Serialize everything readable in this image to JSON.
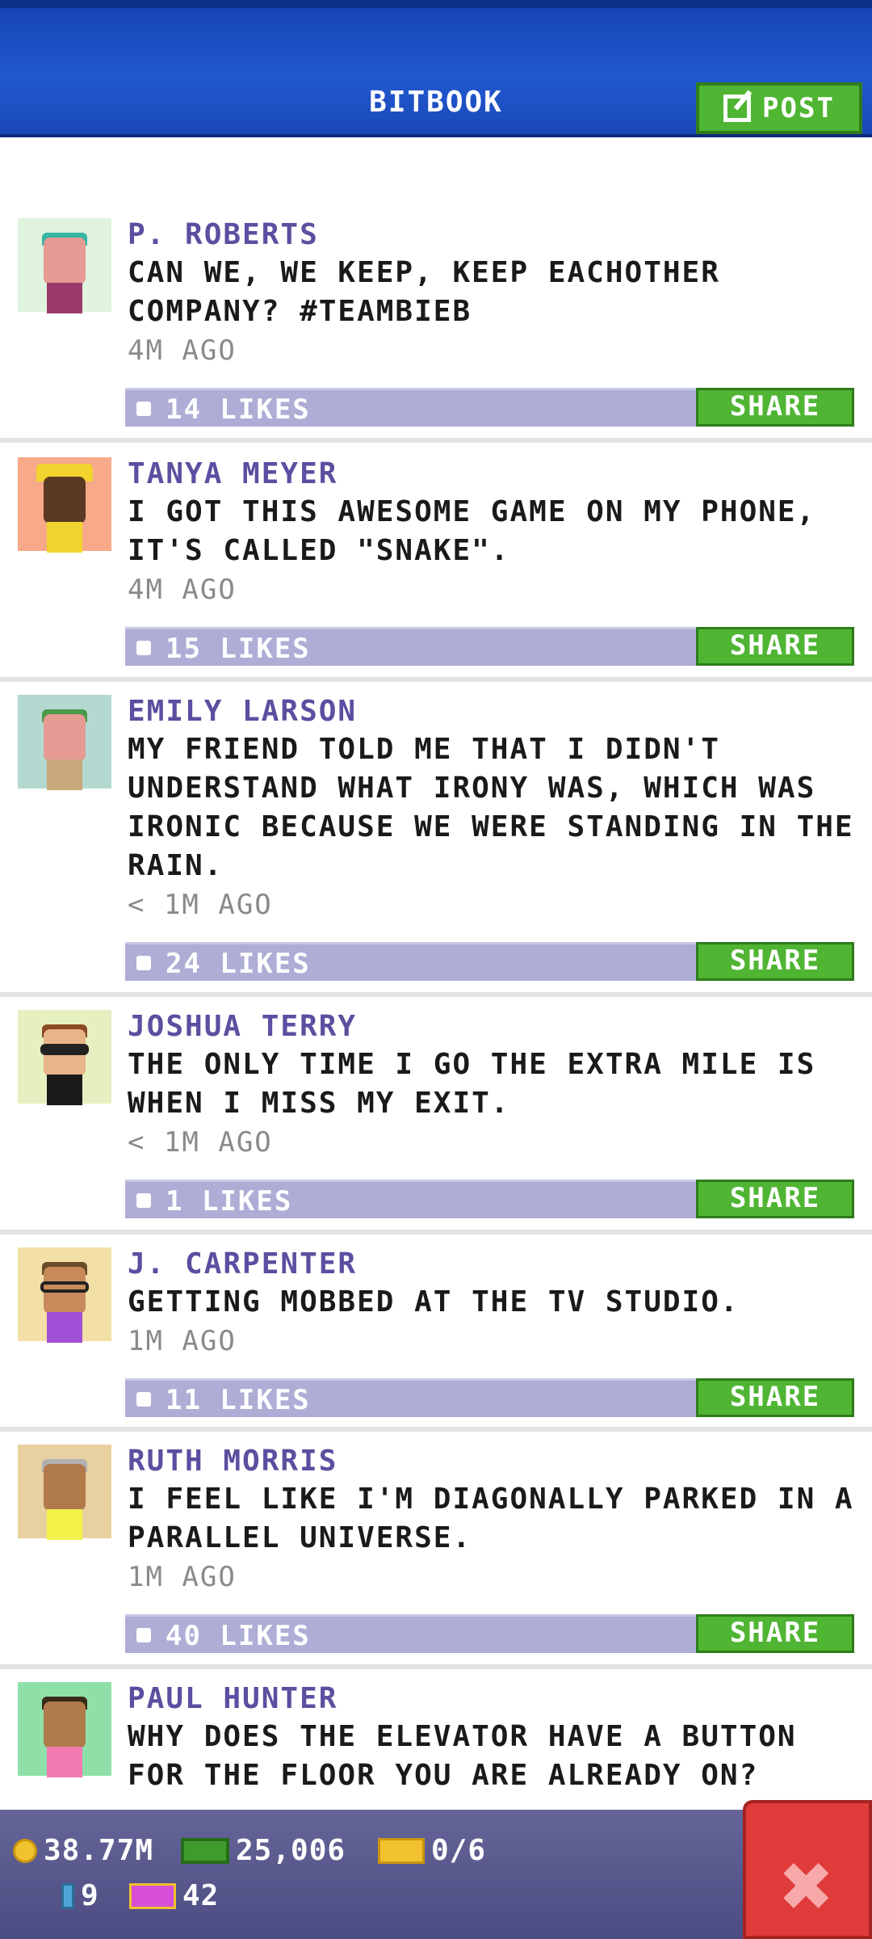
{
  "header": {
    "title": "BITBOOK",
    "post_label": "POST"
  },
  "posts": [
    {
      "name": "P. ROBERTS",
      "text": "CAN WE, WE KEEP, KEEP EACHOTHER COMPANY? #TEAMBIEB",
      "time": "4M AGO",
      "likes": "14 LIKES",
      "share": "SHARE"
    },
    {
      "name": "TANYA MEYER",
      "text": "I GOT THIS AWESOME GAME ON MY PHONE, IT'S CALLED \"SNAKE\".",
      "time": "4M AGO",
      "likes": "15 LIKES",
      "share": "SHARE"
    },
    {
      "name": "EMILY LARSON",
      "text": "MY FRIEND TOLD ME THAT I DIDN'T UNDERSTAND WHAT IRONY WAS, WHICH WAS IRONIC BECAUSE WE WERE STANDING IN THE RAIN.",
      "time": "< 1M AGO",
      "likes": "24 LIKES",
      "share": "SHARE"
    },
    {
      "name": "JOSHUA TERRY",
      "text": "THE ONLY TIME I GO THE EXTRA MILE IS WHEN I MISS MY EXIT.",
      "time": "< 1M AGO",
      "likes": "1 LIKES",
      "share": "SHARE"
    },
    {
      "name": "J. CARPENTER",
      "text": "GETTING MOBBED AT THE TV STUDIO.",
      "time": "1M AGO",
      "likes": "11 LIKES",
      "share": "SHARE"
    },
    {
      "name": "RUTH MORRIS",
      "text": "I FEEL LIKE I'M DIAGONALLY PARKED IN A PARALLEL UNIVERSE.",
      "time": "1M AGO",
      "likes": "40 LIKES",
      "share": "SHARE"
    },
    {
      "name": "PAUL HUNTER",
      "text": "WHY DOES THE ELEVATOR HAVE A BUTTON FOR THE FLOOR YOU ARE ALREADY ON?",
      "time": "",
      "likes": "",
      "share": ""
    }
  ],
  "status": {
    "coins": "38.77M",
    "cash": "25,006",
    "tickets": "0/6",
    "bux": "9",
    "vip": "42"
  },
  "colors": {
    "header_blue": "#2158cf",
    "share_green": "#4fb533",
    "likes_bar": "#adadd6",
    "name_purple": "#5a4fa0",
    "close_red": "#e03b3b"
  }
}
